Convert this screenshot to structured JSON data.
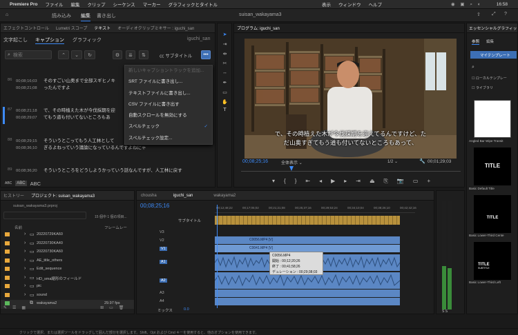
{
  "menubar": {
    "apple": "",
    "app": "Premiere Pro",
    "items": [
      "ファイル",
      "編集",
      "クリップ",
      "シーケンス",
      "マーカー",
      "グラフィックとタイトル",
      "表示",
      "ウィンドウ",
      "ヘルプ"
    ],
    "time": "16:58"
  },
  "workspaces": [
    "読み込み",
    "編集",
    "書き出し"
  ],
  "project_title": "suisan_wakayama3",
  "left_panel": {
    "tabs": [
      "エフェクトコントロール",
      "Lumetri スコープ",
      "テキスト",
      "オーディオクリップミキサー : iguchi_san"
    ],
    "subtabs": [
      "文字起こし",
      "キャプション",
      "グラフィック"
    ],
    "search_placeholder": "検索",
    "subtitle_label": "サブタイトル",
    "rows": [
      {
        "no": "86",
        "tc1": "00;08;16;03",
        "tc2": "00;08;21;08",
        "text1": "そのすごい山奥まで全部スギヒノキ",
        "text2": "ったんですよ"
      },
      {
        "no": "87",
        "tc1": "00;08;21;18",
        "tc2": "00;08;29;07",
        "text1": "で、その時植えた木が今伐採期を迎",
        "text2": "てもう道も付いてないところもあ"
      },
      {
        "no": "88",
        "tc1": "00;08;29;15",
        "tc2": "00;08;36;10",
        "text1": "そういうとこってもう人工林として",
        "text2": "ぎるよねっていう議論になっているんですよねにゃ"
      },
      {
        "no": "89",
        "tc1": "00;08;36;20",
        "tc2": "",
        "text1": "そういうところをどうしようかっていう話なんですが、人工林に戻す",
        "text2": ""
      }
    ],
    "abc": [
      "ABC",
      "ABC",
      "ABC"
    ]
  },
  "context_menu": [
    "新しいキャプショントラックを追加...",
    "SRT ファイルに書き出し...",
    "テキストファイルに書き出し...",
    "CSV ファイルに書き出す",
    "自動スクロールを無効にする",
    "スペルチェック",
    "スペルチェック設定..."
  ],
  "program": {
    "tab": "プログラム: iguchi_san",
    "subtitle1": "で、その時植えた木が今伐採期を迎えてるんですけど、た",
    "subtitle2": "だ山奥すぎてもう道も付いてないところもあって、",
    "timecode": "00;08;25;16",
    "fit": "全体表示",
    "quality": "1/2",
    "duration": "00;01;29;03"
  },
  "project_panel": {
    "tabs": [
      "ヒストリー",
      "プロジェクト: suisan_wakayama3"
    ],
    "file": "suisan_wakayama3.prproj",
    "selected": "15 個中 1 個の項目...",
    "col_name": "名前",
    "col_rate": "フレームレー",
    "items": [
      "20220729KA60",
      "20220730KA40",
      "20220730KA60",
      "AE_title_others",
      "Edit_sequence",
      "HD_sma縮形のフィールド",
      "pic",
      "sound"
    ],
    "seq": "wakayama2",
    "seq_rate": "29.97 fps"
  },
  "timeline": {
    "tabs": [
      "chousha",
      "iguchi_san",
      "wakayama2"
    ],
    "timecode": "00;08;25;16",
    "ruler": [
      "00;12;48;22",
      "00;17;05;02",
      "00;21;21;08",
      "00;25;37;16",
      "00;29;53;24",
      "00;34;10;04",
      "00;38;26;10",
      "00;42;42;16"
    ],
    "subtitle_track": "サブタイトル",
    "tracks": [
      "V3",
      "V2",
      "V1",
      "A1",
      "A2",
      "A3",
      "A4"
    ],
    "clip1": "C0056.MP4 [V]",
    "clip2": "C0041.MP4 [V]",
    "mix": "ミックス",
    "mix_val": "0.0",
    "tooltip": [
      "C0056.MP4",
      "開始 : 00;12;20;26",
      "終了 : 00;41;58;26",
      "デュレーション : 00;29;38;03"
    ]
  },
  "effects": {
    "title": "エッセンシャルグラフィック",
    "tabs": [
      "参照",
      "編集"
    ],
    "dropdown": "マイテンプレート",
    "chk1": "ローカルテンプレー",
    "chk2": "ライブラリ",
    "templates": [
      "Angled Bar Wipe Transit",
      "Basic Default Title",
      "Basic Lower-Third Cente",
      "Basic Lower-Third Left"
    ],
    "thumb_text": "TITLE",
    "thumb_sub": "SUBTITLE"
  },
  "status": "クリックで選択、または選択ツールをドラッグして囲んだ部分を選択します。Shift、Opt および Cmd キーを使用すると、他のオプションを使用できます。",
  "colors": {
    "accent": "#3d8af7",
    "timeline_clip": "#5b87c4",
    "caption_bar": "#b8913c"
  }
}
